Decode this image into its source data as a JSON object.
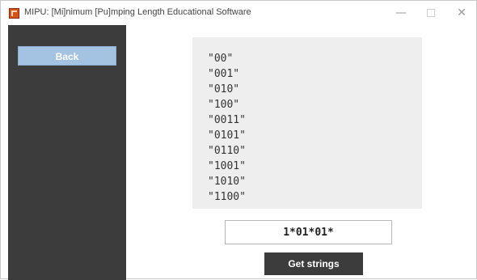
{
  "window": {
    "title": "MIPU: [Mi]nimum [Pu]mping Length Educational Software",
    "minimize_glyph": "—",
    "close_glyph": "✕",
    "icon": "app-logo-icon"
  },
  "sidebar": {
    "back_label": "Back"
  },
  "output": {
    "strings": [
      "\"00\"",
      "\"001\"",
      "\"010\"",
      "\"100\"",
      "\"0011\"",
      "\"0101\"",
      "\"0110\"",
      "\"1001\"",
      "\"1010\"",
      "\"1100\""
    ]
  },
  "regex": {
    "value": "1*01*01*"
  },
  "actions": {
    "get_strings_label": "Get strings"
  },
  "colors": {
    "sidebar_bg": "#3c3c3c",
    "back_button_bg": "#a4c2e2",
    "output_bg": "#eeeeee",
    "app_icon": "#d6521b"
  }
}
